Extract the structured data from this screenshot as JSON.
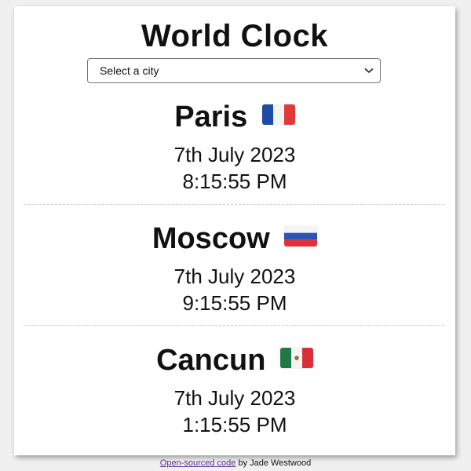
{
  "header": {
    "title": "World Clock"
  },
  "city_select": {
    "selected": "Select a city"
  },
  "cities": [
    {
      "name": "Paris",
      "flag": "france-flag",
      "date": "7th July 2023",
      "time": "8:15:55 PM"
    },
    {
      "name": "Moscow",
      "flag": "russia-flag",
      "date": "7th July 2023",
      "time": "9:15:55 PM"
    },
    {
      "name": "Cancun",
      "flag": "mexico-flag",
      "date": "7th July 2023",
      "time": "1:15:55 PM"
    }
  ],
  "footer": {
    "link_text": "Open-sourced code",
    "author_text": " by Jade Westwood"
  },
  "colors": {
    "background": "#f0f0f0",
    "card": "#ffffff",
    "link": "#5a2d91",
    "divider": "#cfcfcf"
  }
}
